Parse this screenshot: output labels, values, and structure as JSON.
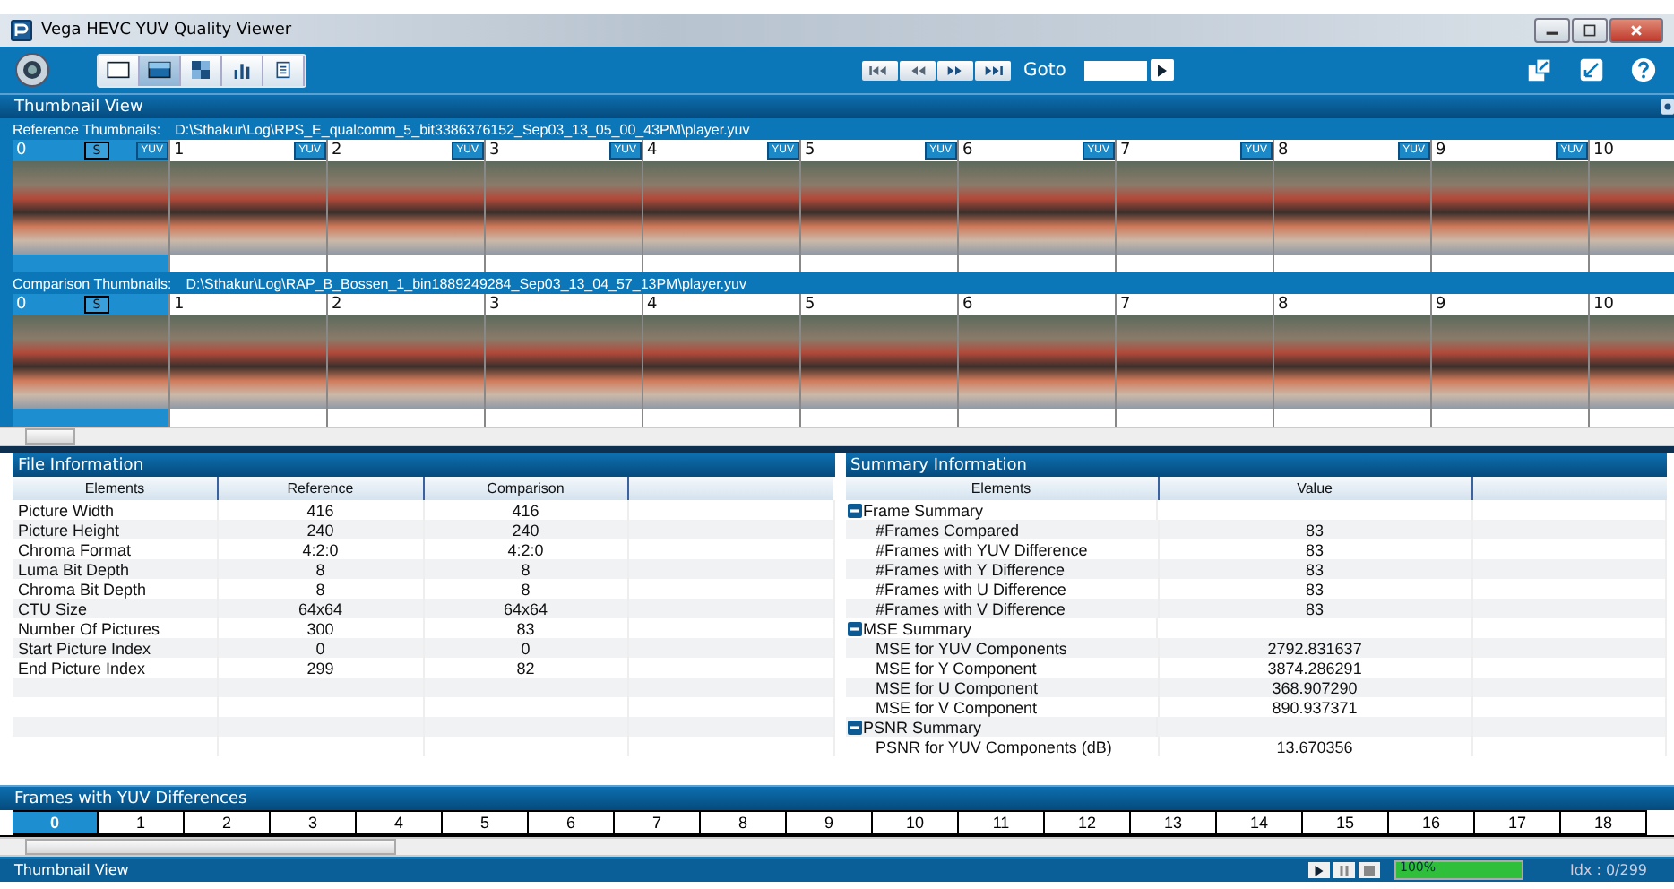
{
  "window": {
    "title": "Vega HEVC YUV Quality Viewer"
  },
  "toolbar": {
    "view_buttons": [
      {
        "kind": "single",
        "selected": false
      },
      {
        "kind": "split",
        "selected": true
      },
      {
        "kind": "checker",
        "selected": false
      },
      {
        "kind": "chart",
        "selected": false
      },
      {
        "kind": "report",
        "selected": false
      }
    ],
    "nav_buttons": [
      {
        "kind": "first"
      },
      {
        "kind": "prev"
      },
      {
        "kind": "next"
      },
      {
        "kind": "last"
      }
    ],
    "goto": {
      "label": "Goto"
    }
  },
  "thumbnail_view": {
    "title": "Thumbnail View",
    "reference": {
      "label": "Reference Thumbnails:",
      "path": "D:\\Sthakur\\Log\\RPS_E_qualcomm_5_bit3386376152_Sep03_13_05_00_43PM\\player.yuv",
      "frames": [
        {
          "number": "0",
          "selected": true,
          "marker": "S",
          "badge": "YUV"
        },
        {
          "number": "1",
          "selected": false,
          "badge": "YUV"
        },
        {
          "number": "2",
          "selected": false,
          "badge": "YUV"
        },
        {
          "number": "3",
          "selected": false,
          "badge": "YUV"
        },
        {
          "number": "4",
          "selected": false,
          "badge": "YUV"
        },
        {
          "number": "5",
          "selected": false,
          "badge": "YUV"
        },
        {
          "number": "6",
          "selected": false,
          "badge": "YUV"
        },
        {
          "number": "7",
          "selected": false,
          "badge": "YUV"
        },
        {
          "number": "8",
          "selected": false,
          "badge": "YUV"
        },
        {
          "number": "9",
          "selected": false,
          "badge": "YUV"
        },
        {
          "number": "10",
          "selected": false
        }
      ]
    },
    "comparison": {
      "label": "Comparison Thumbnails:",
      "path": "D:\\Sthakur\\Log\\RAP_B_Bossen_1_bin1889249284_Sep03_13_04_57_13PM\\player.yuv",
      "frames": [
        {
          "number": "0",
          "selected": true,
          "marker": "S"
        },
        {
          "number": "1",
          "selected": false
        },
        {
          "number": "2",
          "selected": false
        },
        {
          "number": "3",
          "selected": false
        },
        {
          "number": "4",
          "selected": false
        },
        {
          "number": "5",
          "selected": false
        },
        {
          "number": "6",
          "selected": false
        },
        {
          "number": "7",
          "selected": false
        },
        {
          "number": "8",
          "selected": false
        },
        {
          "number": "9",
          "selected": false
        },
        {
          "number": "10",
          "selected": false
        }
      ]
    }
  },
  "file_information": {
    "title": "File Information",
    "columns": [
      "Elements",
      "Reference",
      "Comparison"
    ],
    "rows": [
      [
        "Picture Width",
        "416",
        "416"
      ],
      [
        "Picture Height",
        "240",
        "240"
      ],
      [
        "Chroma Format",
        "4:2:0",
        "4:2:0"
      ],
      [
        "Luma Bit Depth",
        "8",
        "8"
      ],
      [
        "Chroma Bit Depth",
        "8",
        "8"
      ],
      [
        "CTU Size",
        "64x64",
        "64x64"
      ],
      [
        "Number Of Pictures",
        "300",
        "83"
      ],
      [
        "Start Picture Index",
        "0",
        "0"
      ],
      [
        "End Picture Index",
        "299",
        "82"
      ]
    ]
  },
  "summary_information": {
    "title": "Summary Information",
    "columns": [
      "Elements",
      "Value"
    ],
    "groups": [
      {
        "name": "Frame Summary",
        "expanded": true,
        "children": [
          {
            "label": "#Frames Compared",
            "value": "83"
          },
          {
            "label": "#Frames with YUV Difference",
            "value": "83"
          },
          {
            "label": "#Frames with Y Difference",
            "value": "83"
          },
          {
            "label": "#Frames with U Difference",
            "value": "83"
          },
          {
            "label": "#Frames with V Difference",
            "value": "83"
          }
        ]
      },
      {
        "name": "MSE Summary",
        "expanded": true,
        "children": [
          {
            "label": "MSE for YUV Components",
            "value": "2792.831637"
          },
          {
            "label": "MSE for Y Component",
            "value": "3874.286291"
          },
          {
            "label": "MSE for U Component",
            "value": "368.907290"
          },
          {
            "label": "MSE for V Component",
            "value": "890.937371"
          }
        ]
      },
      {
        "name": "PSNR Summary",
        "expanded": true,
        "children": [
          {
            "label": "PSNR for YUV Components (dB)",
            "value": "13.670356"
          }
        ]
      }
    ]
  },
  "frames_with_differences": {
    "title": "Frames with YUV Differences",
    "frames": [
      {
        "label": "0",
        "selected": true
      },
      {
        "label": "1",
        "selected": false
      },
      {
        "label": "2",
        "selected": false
      },
      {
        "label": "3",
        "selected": false
      },
      {
        "label": "4",
        "selected": false
      },
      {
        "label": "5",
        "selected": false
      },
      {
        "label": "6",
        "selected": false
      },
      {
        "label": "7",
        "selected": false
      },
      {
        "label": "8",
        "selected": false
      },
      {
        "label": "9",
        "selected": false
      },
      {
        "label": "10",
        "selected": false
      },
      {
        "label": "11",
        "selected": false
      },
      {
        "label": "12",
        "selected": false
      },
      {
        "label": "13",
        "selected": false
      },
      {
        "label": "14",
        "selected": false
      },
      {
        "label": "15",
        "selected": false
      },
      {
        "label": "16",
        "selected": false
      },
      {
        "label": "17",
        "selected": false
      },
      {
        "label": "18",
        "selected": false
      }
    ]
  },
  "status_bar": {
    "view": "Thumbnail View",
    "playback": [
      {
        "kind": "play"
      },
      {
        "kind": "pause"
      },
      {
        "kind": "stop"
      }
    ],
    "progress": {
      "level": 1,
      "label": "100%"
    },
    "index": "Idx : 0/299"
  }
}
